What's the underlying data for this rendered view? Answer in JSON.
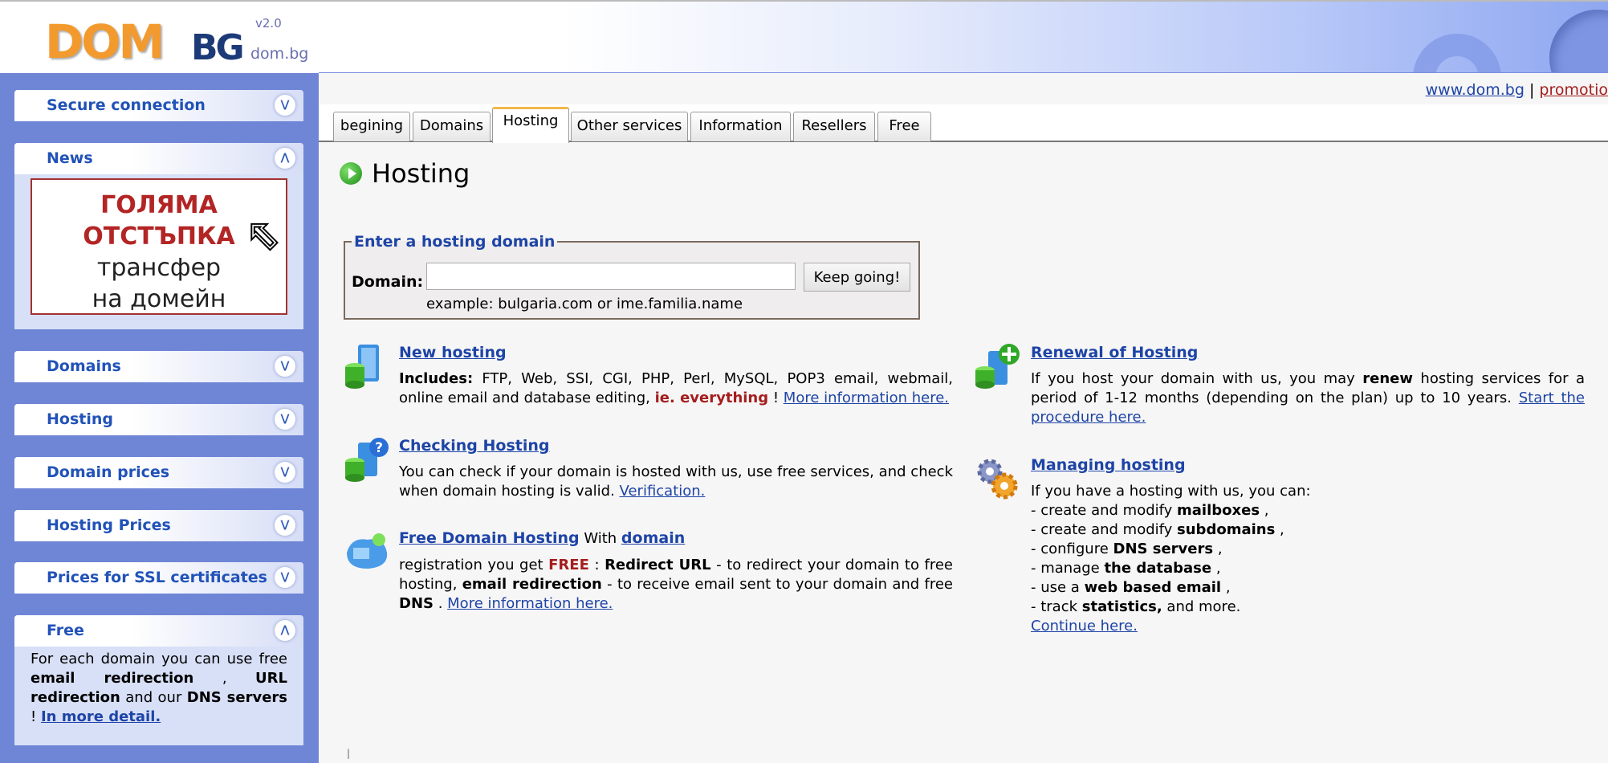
{
  "header": {
    "logo_dom": "DOM",
    "logo_bg": "BG",
    "logo_version": "v2.0",
    "logo_url": "dom.bg"
  },
  "topnav": {
    "home": "www.dom.bg",
    "separator": "|",
    "promo": "promotio"
  },
  "sidebar": {
    "secure": "Secure connection",
    "news": "News",
    "banner": {
      "line1": "ГОЛЯМА",
      "line2": "ОТСТЪПКА",
      "line3": "трансфер",
      "line4": "на домейн"
    },
    "domains": "Domains",
    "hosting": "Hosting",
    "domain_prices": "Domain prices",
    "hosting_prices": "Hosting Prices",
    "ssl": "Prices for SSL certificates",
    "free": {
      "title": "Free",
      "t1": "For each domain you can use free ",
      "b1": "email redirection",
      "t2": " , ",
      "b2": "URL redirection",
      "t3": " and our ",
      "b3": "DNS servers",
      "t4": " ! ",
      "link": "In more detail."
    }
  },
  "tabs": [
    "begining",
    "Domains",
    "Hosting",
    "Other services",
    "Information",
    "Resellers",
    "Free"
  ],
  "active_tab": "Hosting",
  "main": {
    "title": "Hosting",
    "form": {
      "legend": "Enter a hosting domain",
      "label": "Domain:",
      "value": "",
      "button": "Keep going!",
      "example": "example: bulgaria.com or ime.familia.name"
    },
    "new_hosting": {
      "title": "New hosting",
      "b1": "Includes:",
      "t1": " FTP, Web, SSI, CGI, PHP, Perl, MySQL, POP3 email, webmail, online email and database editing, ",
      "red": "ie. everything",
      "t2": " ! ",
      "link": "More information here."
    },
    "checking": {
      "title": "Checking Hosting",
      "t1": "You can check if your domain is hosted with us, use free services, and check when domain hosting is valid. ",
      "link": "Verification."
    },
    "free_hosting": {
      "title": "Free Domain Hosting",
      "t0": " With ",
      "title2": "domain",
      "t1": "registration you get ",
      "red": "FREE",
      "t2": " : ",
      "b1": "Redirect URL",
      "t3": " - to redirect your domain to free hosting, ",
      "b2": "email redirection",
      "t4": " - to receive email sent to your domain and free ",
      "b3": "DNS",
      "t5": " . ",
      "link": "More information here."
    },
    "renewal": {
      "title": "Renewal of Hosting",
      "t1": "If you host your domain with us, you may ",
      "b1": "renew",
      "t2": " hosting services for a period of 1-12 months (depending on the plan) up to 10 years. ",
      "link": "Start the procedure here."
    },
    "managing": {
      "title": "Managing hosting",
      "intro": "If you have a hosting with us, you can:",
      "lines": [
        {
          "pre": "- create and modify ",
          "b": "mailboxes",
          "post": " ,"
        },
        {
          "pre": "- create and modify ",
          "b": "subdomains",
          "post": " ,"
        },
        {
          "pre": "- configure ",
          "b": "DNS servers",
          "post": " ,"
        },
        {
          "pre": "- manage ",
          "b": "the database",
          "post": " ,"
        },
        {
          "pre": "- use a ",
          "b": "web based email",
          "post": " ,"
        },
        {
          "pre": "- track ",
          "b": "statistics,",
          "post": " and more."
        }
      ],
      "link": "Continue here."
    },
    "footer_mark": "|"
  },
  "colors": {
    "sidebar_bg": "#6f86d6",
    "link": "#1d44a6",
    "accent_red": "#a41e1e",
    "logo_orange": "#f39a2f",
    "logo_navy": "#1c3a78"
  }
}
